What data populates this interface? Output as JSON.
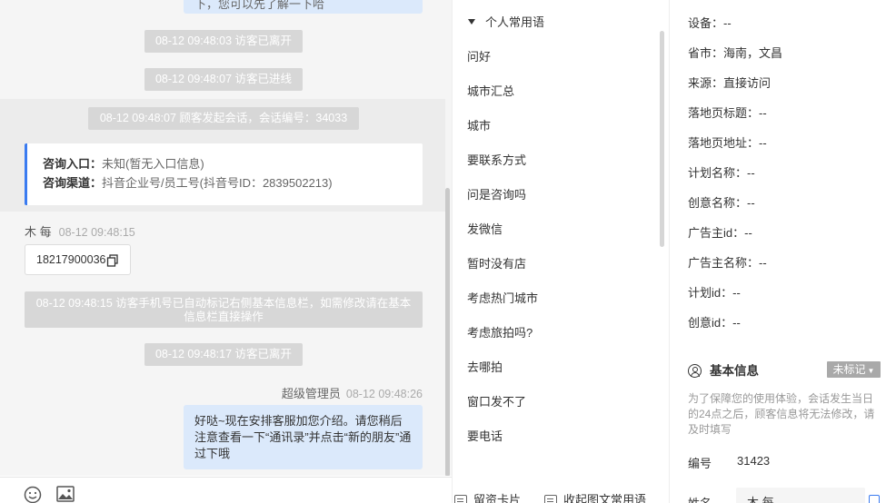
{
  "chat": {
    "top_bubble_text": "下，您可以先了解一下哈",
    "system_messages": [
      "08-12 09:48:03 访客已离开",
      "08-12 09:48:07 访客已进线",
      "08-12 09:48:07 顾客发起会话，会话编号：34033",
      "08-12 09:48:15 访客手机号已自动标记右侧基本信息栏，如需修改请在基本信息栏直接操作",
      "08-12 09:48:17 访客已离开"
    ],
    "entry_label": "咨询入口：",
    "entry_value": "未知(暂无入口信息)",
    "channel_label": "咨询渠道：",
    "channel_value": "抖音企业号/员工号(抖音号ID：2839502213)",
    "visitor_name": "木 每",
    "visitor_time": "08-12 09:48:15",
    "visitor_phone": "18217900036",
    "admin_name": "超级管理员",
    "admin_time": "08-12 09:48:26",
    "admin_message": "好哒~现在安排客服加您介绍。请您稍后注意查看一下“通讯录”并点击“新的朋友”通过下哦"
  },
  "toolbar": {
    "icons": [
      "emoji-icon",
      "image-icon"
    ]
  },
  "phrases": {
    "header": "个人常用语",
    "items": [
      "问好",
      "城市汇总",
      "城市",
      "要联系方式",
      "问是咨询吗",
      "发微信",
      "暂时没有店",
      "考虑热门城市",
      "考虑旅拍吗?",
      "去哪拍",
      "窗口发不了",
      "要电话"
    ],
    "leave_card_label": "留资卡片",
    "collapse_label": "收起图文常用语"
  },
  "info": {
    "fields": [
      {
        "label": "设备：",
        "value": "--"
      },
      {
        "label": "省市：",
        "value": "海南，文昌"
      },
      {
        "label": "来源：",
        "value": "直接访问"
      },
      {
        "label": "落地页标题：",
        "value": "--"
      },
      {
        "label": "落地页地址：",
        "value": "--"
      },
      {
        "label": "计划名称：",
        "value": "--"
      },
      {
        "label": "创意名称：",
        "value": "--"
      },
      {
        "label": "广告主id：",
        "value": "--"
      },
      {
        "label": "广告主名称：",
        "value": "--"
      },
      {
        "label": "计划id：",
        "value": "--"
      },
      {
        "label": "创意id：",
        "value": "--"
      }
    ],
    "basic_title": "基本信息",
    "mark_label": "未标记",
    "notice": "为了保障您的使用体验，会话发生当日的24点之后，顾客信息将无法修改，请及时填写",
    "number_label": "编号",
    "number_value": "31423",
    "name_label": "姓名",
    "name_value": "木 每"
  },
  "colors": {
    "accent": "#3a7bf0",
    "system_bg": "#d7d7d7",
    "bubble_bg": "#dbe9fb"
  }
}
